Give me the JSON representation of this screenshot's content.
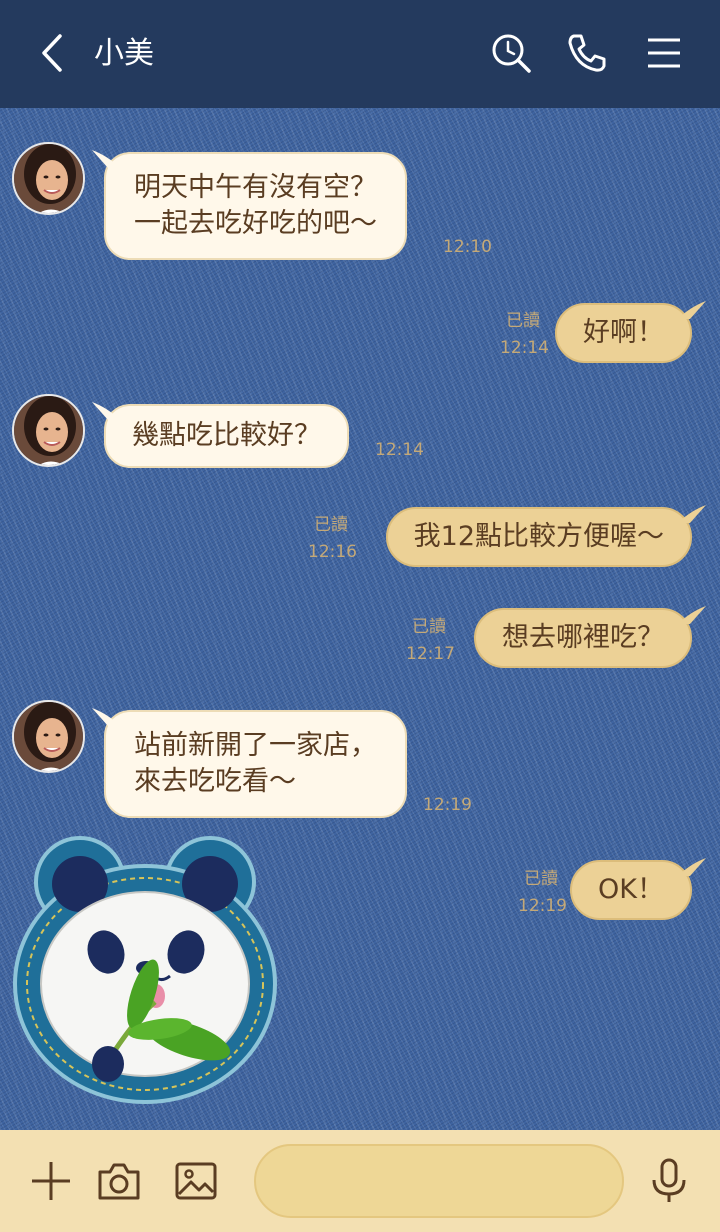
{
  "header": {
    "title": "小美",
    "icons": [
      "back-icon",
      "search-icon",
      "phone-icon",
      "menu-icon"
    ],
    "background": "#243a5e"
  },
  "messages": [
    {
      "side": "incoming",
      "lines": [
        "明天中午有沒有空？",
        "一起去吃好吃的吧～"
      ],
      "time": "12:10"
    },
    {
      "side": "outgoing",
      "text": "好啊！",
      "read": "已讀",
      "time": "12:14"
    },
    {
      "side": "incoming",
      "lines": [
        "幾點吃比較好？"
      ],
      "time": "12:14"
    },
    {
      "side": "outgoing",
      "text": "我12點比較方便喔～",
      "read": "已讀",
      "time": "12:16"
    },
    {
      "side": "outgoing",
      "text": "想去哪裡吃？",
      "read": "已讀",
      "time": "12:17"
    },
    {
      "side": "incoming",
      "lines": [
        "站前新開了一家店，",
        "來去吃吃看～"
      ],
      "time": "12:19"
    },
    {
      "side": "outgoing",
      "text": "OK！",
      "read": "已讀",
      "time": "12:19"
    }
  ],
  "sticker": {
    "name": "panda-denim-patch"
  },
  "input": {
    "placeholder": "",
    "icons": [
      "plus-icon",
      "camera-icon",
      "image-icon",
      "emoji-icon",
      "mic-icon"
    ]
  },
  "colors": {
    "incoming_bubble": "#fff8ea",
    "outgoing_bubble": "#ecd196",
    "text": "#5a3d22",
    "timestamp": "#c4a978",
    "input_bar": "#f3e0b2"
  }
}
